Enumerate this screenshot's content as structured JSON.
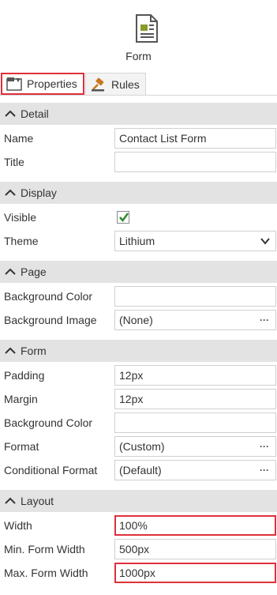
{
  "header": {
    "title": "Form",
    "icon": "form-document-icon"
  },
  "tabs": [
    {
      "label": "Properties",
      "icon": "properties-icon",
      "active": true
    },
    {
      "label": "Rules",
      "icon": "rules-gavel-icon",
      "active": false
    }
  ],
  "sections": {
    "detail": {
      "title": "Detail",
      "name": {
        "label": "Name",
        "value": "Contact List Form"
      },
      "title_field": {
        "label": "Title",
        "value": ""
      }
    },
    "display": {
      "title": "Display",
      "visible": {
        "label": "Visible",
        "checked": true
      },
      "theme": {
        "label": "Theme",
        "value": "Lithium"
      }
    },
    "page": {
      "title": "Page",
      "background_color": {
        "label": "Background Color",
        "value": ""
      },
      "background_image": {
        "label": "Background Image",
        "value": "(None)"
      }
    },
    "form": {
      "title": "Form",
      "padding": {
        "label": "Padding",
        "value": "12px"
      },
      "margin": {
        "label": "Margin",
        "value": "12px"
      },
      "background_color": {
        "label": "Background Color",
        "value": ""
      },
      "format": {
        "label": "Format",
        "value": "(Custom)"
      },
      "conditional_format": {
        "label": "Conditional Format",
        "value": "(Default)"
      }
    },
    "layout": {
      "title": "Layout",
      "width": {
        "label": "Width",
        "value": "100%"
      },
      "min_width": {
        "label": "Min. Form Width",
        "value": "500px"
      },
      "max_width": {
        "label": "Max. Form Width",
        "value": "1000px"
      }
    }
  },
  "more_glyph": "···",
  "colors": {
    "highlight": "#e0303a",
    "section_bg": "#e3e3e3",
    "check": "#2e8b2e"
  }
}
